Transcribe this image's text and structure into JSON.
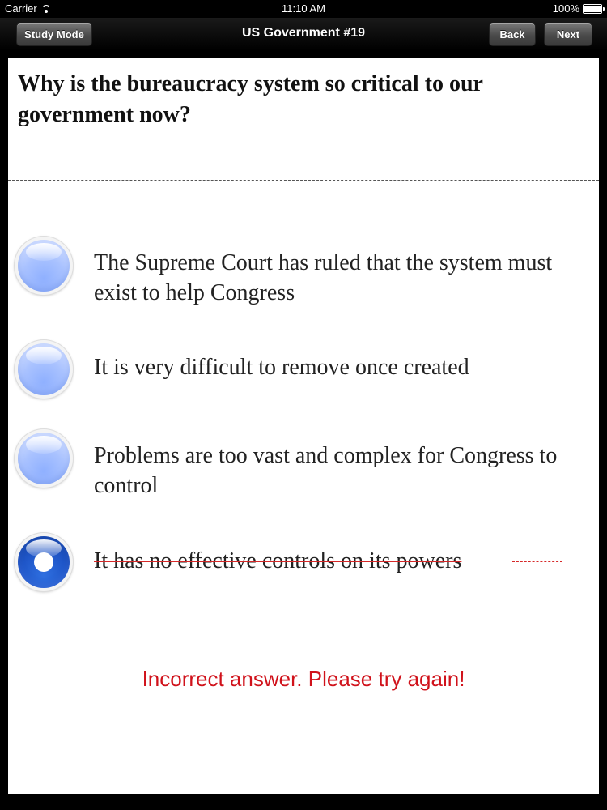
{
  "status_bar": {
    "carrier": "Carrier",
    "wifi_icon": "wifi-icon",
    "time": "11:10 AM",
    "battery_percent": "100%",
    "battery_icon": "battery-icon"
  },
  "nav": {
    "study_mode_label": "Study Mode",
    "title": "US Government #19",
    "back_label": "Back",
    "next_label": "Next"
  },
  "question": "Why is the bureaucracy system so critical to our government now?",
  "options": [
    {
      "text": "The Supreme Court has ruled that the system must exist to help Congress",
      "selected": false,
      "marked_wrong": false
    },
    {
      "text": "It is very difficult to remove once created",
      "selected": false,
      "marked_wrong": false
    },
    {
      "text": "Problems are too vast and complex for Congress to control",
      "selected": false,
      "marked_wrong": false
    },
    {
      "text": "It has no effective controls on its powers",
      "selected": true,
      "marked_wrong": true
    }
  ],
  "feedback": "Incorrect answer. Please try again!",
  "colors": {
    "feedback_red": "#d0121b",
    "radio_blue_light": "#a9c2ff",
    "radio_blue_selected": "#1f56c8",
    "strike_red": "#d62828"
  }
}
